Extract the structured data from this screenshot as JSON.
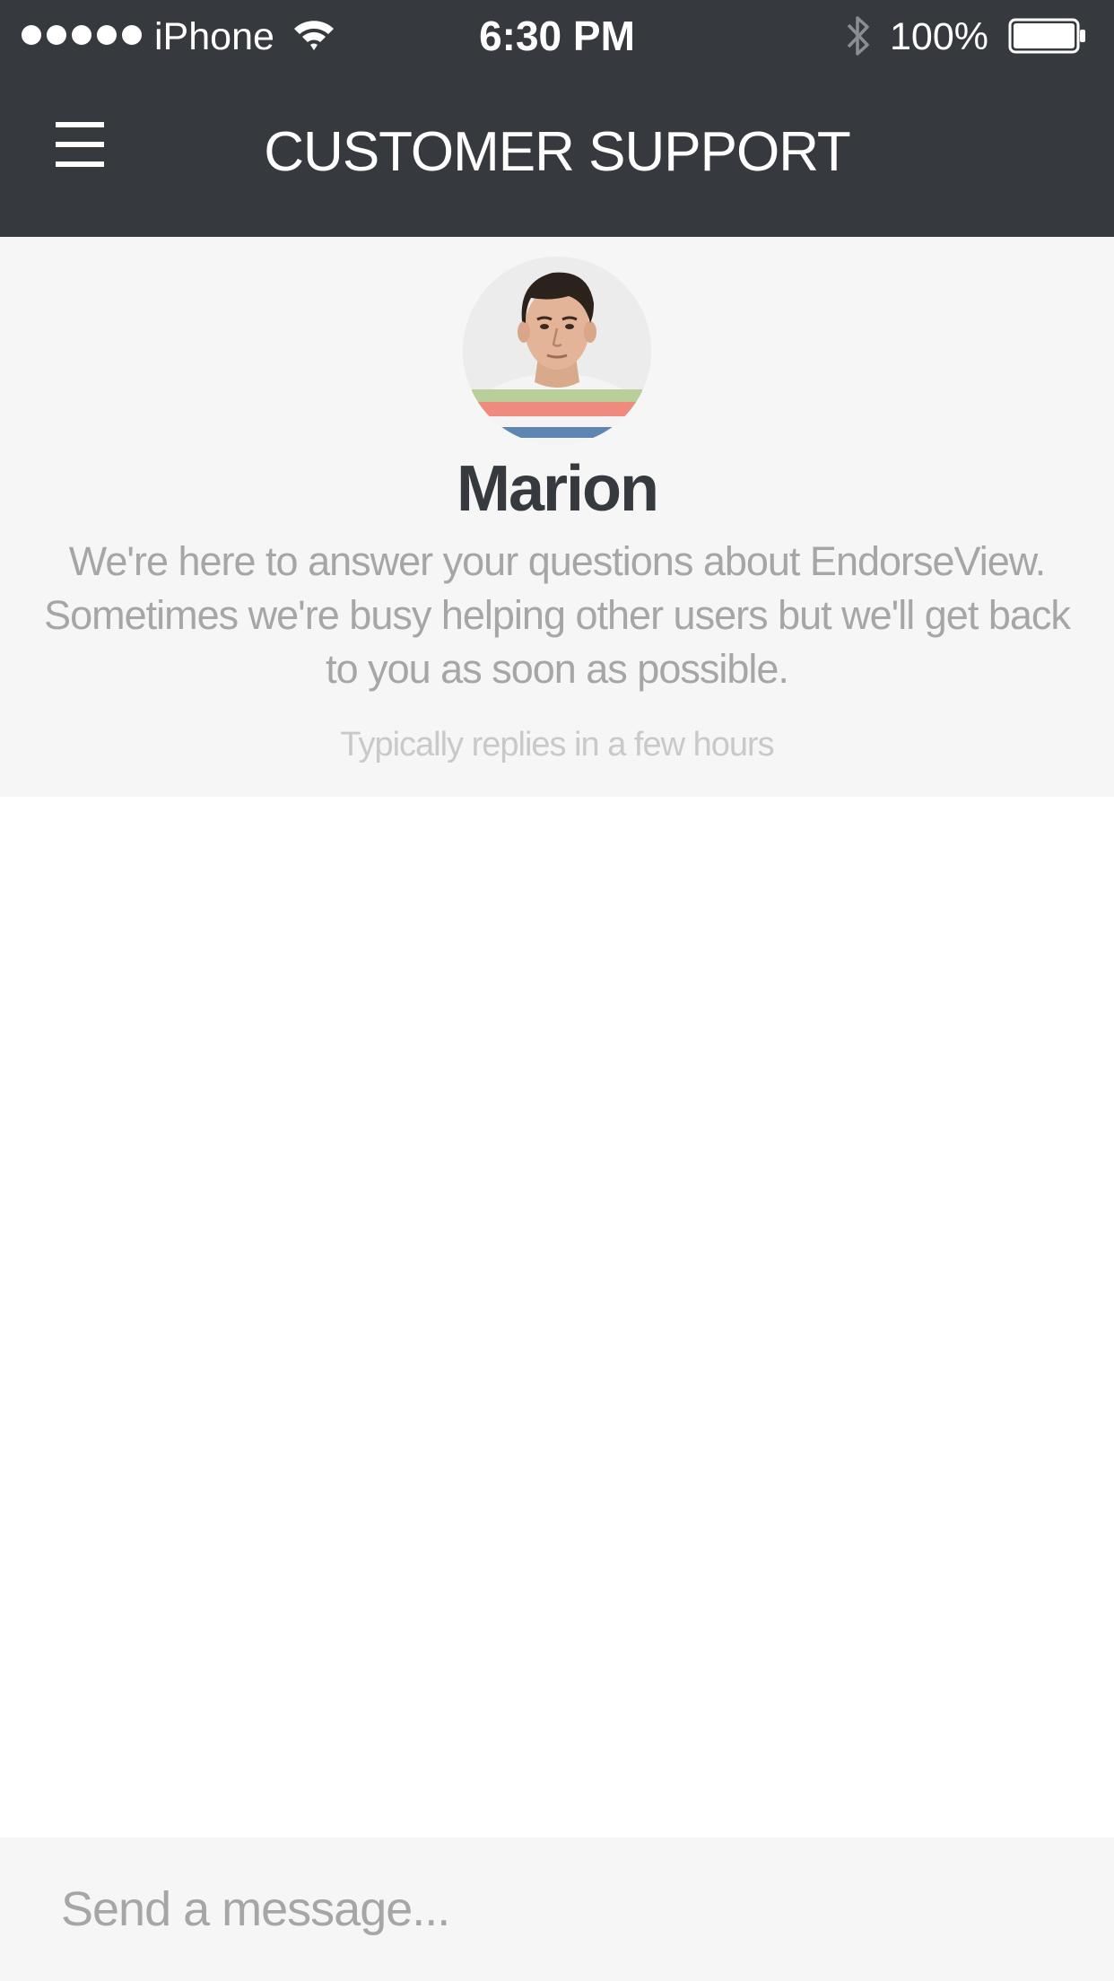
{
  "status_bar": {
    "carrier": "iPhone",
    "time": "6:30 PM",
    "battery_percent": "100%",
    "signal_bars": 5,
    "battery_level": 1.0,
    "icons": [
      "signal-dots-icon",
      "wifi-icon",
      "bluetooth-icon",
      "battery-icon"
    ]
  },
  "nav": {
    "menu_icon": "menu-icon",
    "title": "CUSTOMER SUPPORT"
  },
  "profile": {
    "name": "Marion",
    "intro": "We're here to answer your questions about EndorseView. Sometimes we're busy helping other users but we'll get back to you as soon as possible.",
    "reply_time": "Typically replies in a few hours"
  },
  "composer": {
    "placeholder": "Send a message...",
    "value": ""
  },
  "colors": {
    "header_bg": "#363a3f",
    "panel_bg": "#f6f6f6",
    "name_text": "#363a3f",
    "muted_text": "#a6a6a6",
    "faint_text": "#c9c9c9"
  }
}
